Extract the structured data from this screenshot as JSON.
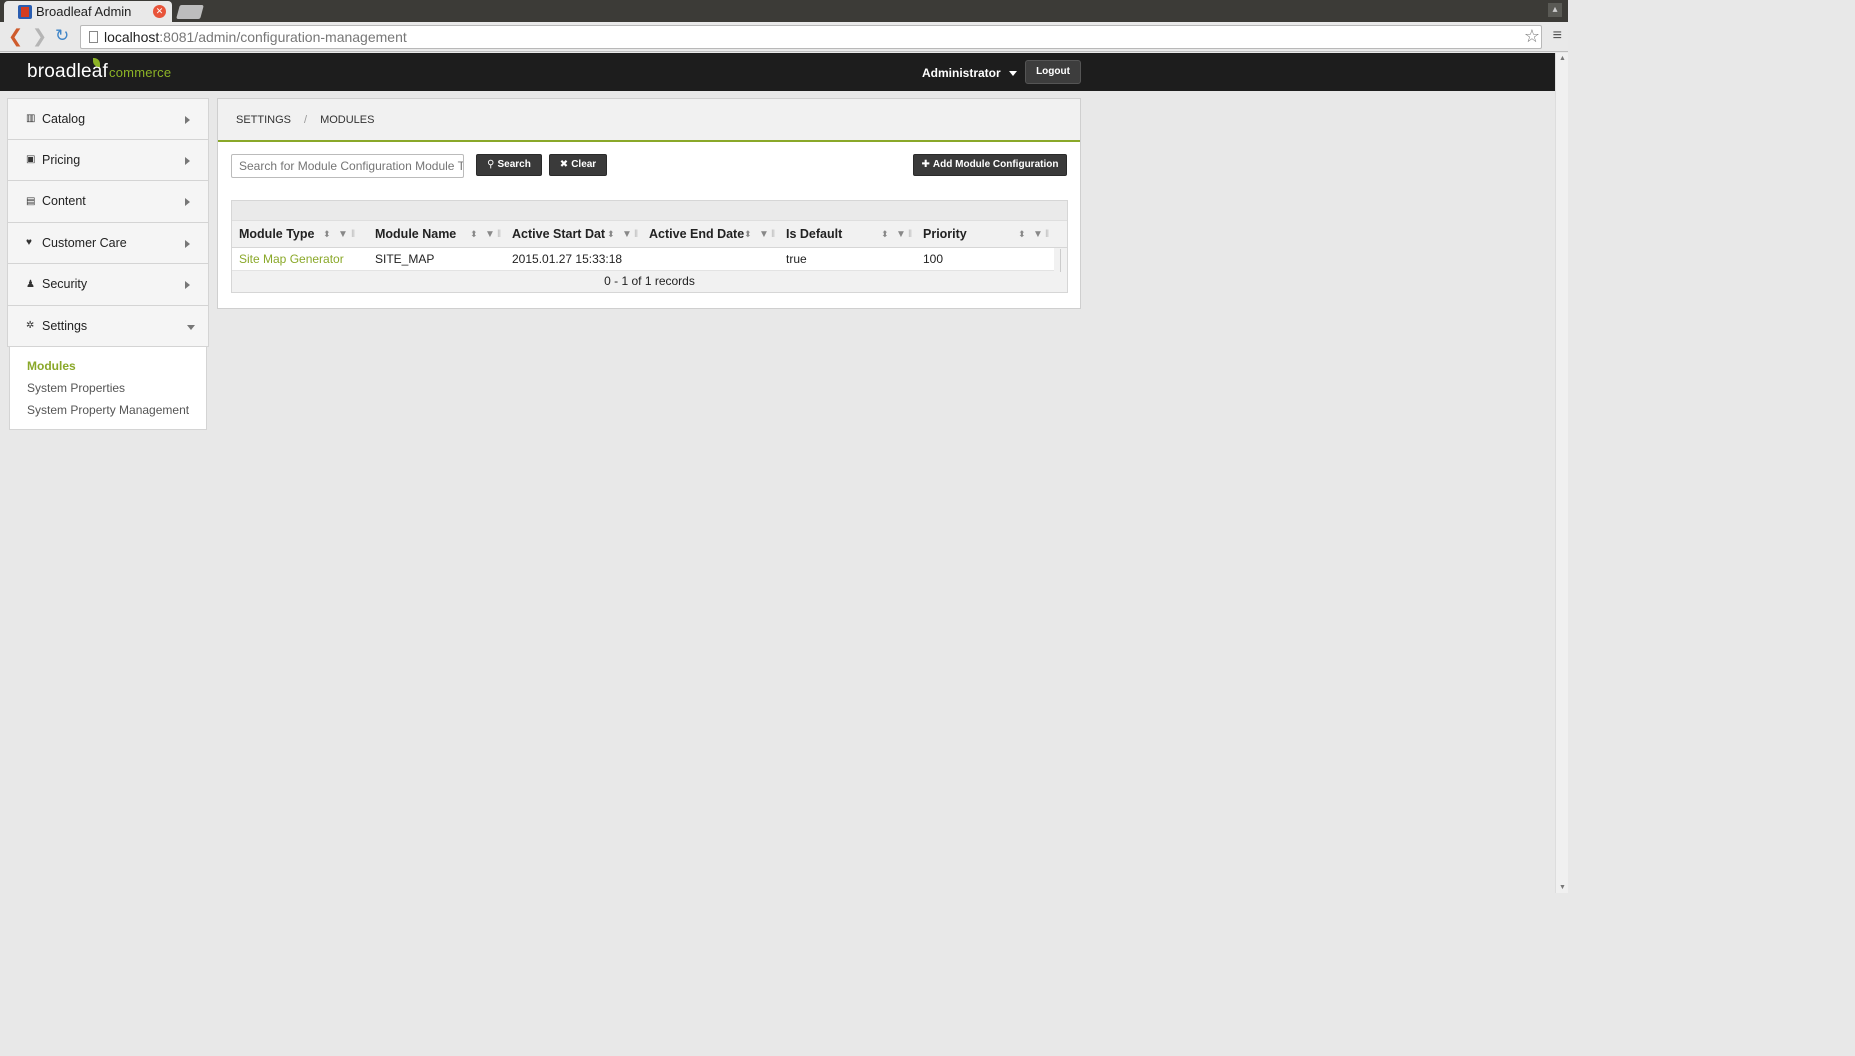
{
  "browser": {
    "tab_title": "Broadleaf Admin",
    "url_host": "localhost",
    "url_rest": ":8081/admin/configuration-management"
  },
  "header": {
    "logo_text": "broadleaf",
    "logo_suffix": "commerce",
    "user_label": "Administrator",
    "logout_label": "Logout"
  },
  "sidebar": {
    "items": [
      {
        "label": "Catalog",
        "icon": "catalog-icon"
      },
      {
        "label": "Pricing",
        "icon": "money-icon"
      },
      {
        "label": "Content",
        "icon": "file-icon"
      },
      {
        "label": "Customer Care",
        "icon": "heart-icon"
      },
      {
        "label": "Security",
        "icon": "user-icon"
      },
      {
        "label": "Settings",
        "icon": "gear-icon"
      }
    ],
    "subnav": [
      "Modules",
      "System Properties",
      "System Property Management"
    ]
  },
  "breadcrumb": {
    "root": "SETTINGS",
    "separator": "/",
    "current": "MODULES"
  },
  "toolbar": {
    "search_placeholder": "Search for Module Configuration Module T",
    "search_label": "Search",
    "clear_label": "Clear",
    "add_label": "Add Module Configuration"
  },
  "grid": {
    "columns": [
      "Module Type",
      "Module Name",
      "Active Start Dat",
      "Active End Date",
      "Is Default",
      "Priority"
    ],
    "rows": [
      [
        "Site Map Generator",
        "SITE_MAP",
        "2015.01.27 15:33:18",
        "",
        "true",
        "100"
      ]
    ],
    "footer": "0 - 1 of 1 records"
  },
  "colors": {
    "accent": "#8aa829",
    "header_bg": "#1d1d1d",
    "button_bg": "#3a3a3a"
  }
}
